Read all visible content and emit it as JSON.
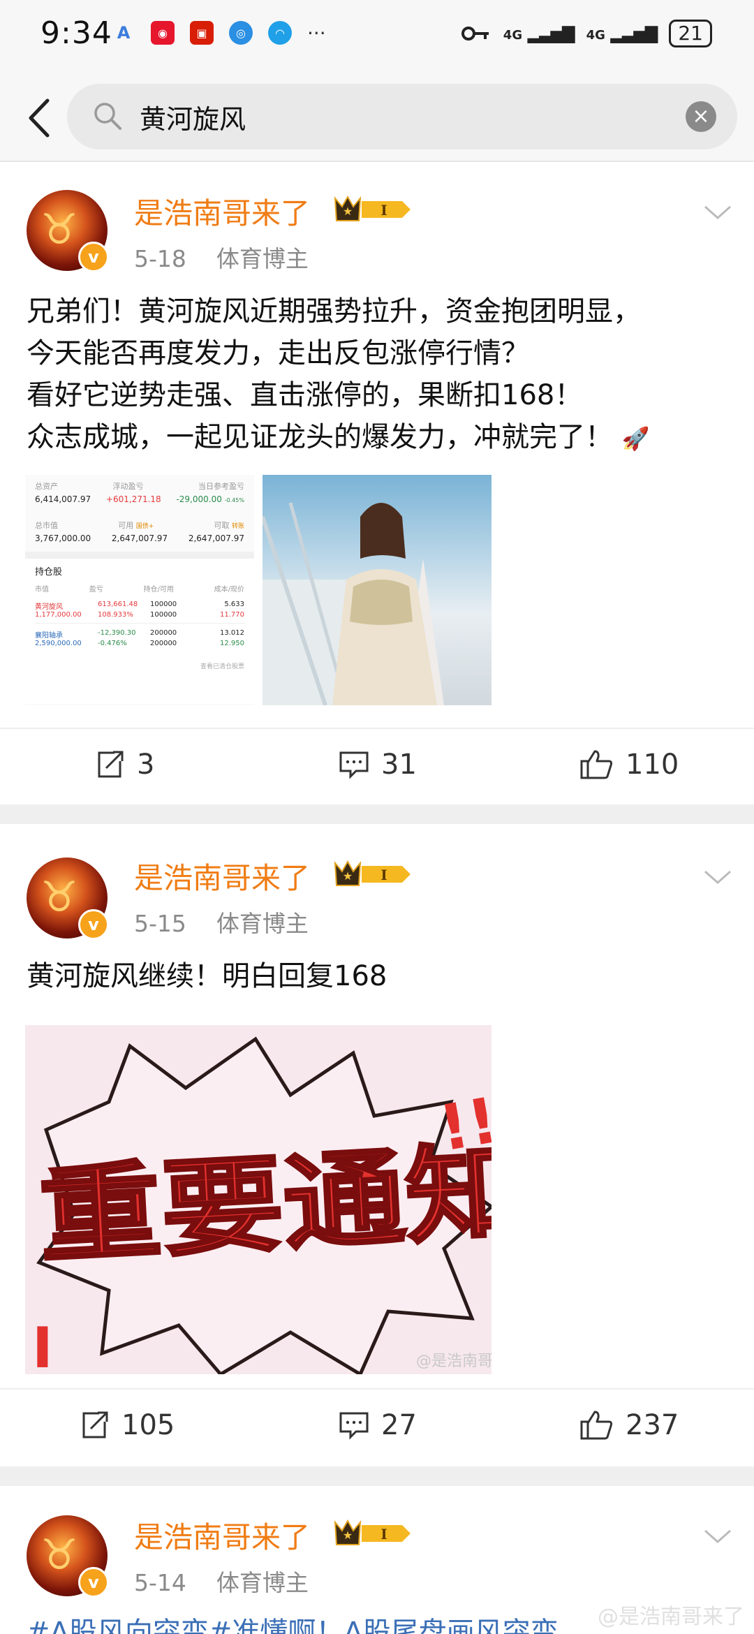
{
  "status": {
    "time": "9:34",
    "network_1": "4G",
    "network_2": "4G",
    "battery": "21",
    "more": "···"
  },
  "search": {
    "query": "黄河旋风"
  },
  "posts": [
    {
      "username": "是浩南哥来了",
      "level_badge": "I",
      "date": "5-18",
      "category": "体育博主",
      "lines": [
        "兄弟们！黄河旋风近期强势拉升，资金抱团明显，",
        "今天能否再度发力，走出反包涨停行情？",
        "看好它逆势走强、直击涨停的，果断扣168！",
        "众志成城，一起见证龙头的爆发力，冲就完了！"
      ],
      "repost_count": "3",
      "comment_count": "31",
      "like_count": "110",
      "portfolio": {
        "labels_row1": [
          "总资产",
          "浮动盈亏",
          "当日参考盈亏"
        ],
        "values_row1": [
          "6,414,007.97",
          "+601,271.18",
          "-29,000.00"
        ],
        "pct_row1": "-0.45%",
        "labels_row2": [
          "总市值",
          "可用",
          "可取"
        ],
        "values_row2": [
          "3,767,000.00",
          "2,647,007.97",
          "2,647,007.97"
        ],
        "tag_available": "国债+",
        "tag_withdraw": "转账",
        "holdings_title": "持仓股",
        "headers": [
          "市值",
          "盈亏",
          "持仓/可用",
          "成本/现价"
        ],
        "rows": [
          {
            "name": "黄河旋风",
            "value": "1,177,000.00",
            "pl": "613,661.48",
            "plpct": "108.933%",
            "pos": "100000",
            "avail": "100000",
            "cost": "5.633",
            "price": "11.770"
          },
          {
            "name": "襄阳轴承",
            "value": "2,590,000.00",
            "pl": "-12,390.30",
            "plpct": "-0.476%",
            "pos": "200000",
            "avail": "200000",
            "cost": "13.012",
            "price": "12.950"
          }
        ],
        "footer": "查看已清仓股票"
      }
    },
    {
      "username": "是浩南哥来了",
      "level_badge": "I",
      "date": "5-15",
      "category": "体育博主",
      "lines": [
        "黄河旋风继续！明白回复168"
      ],
      "poster_text": "重要通知",
      "poster_marks": "!!!",
      "poster_watermark": "@是浩南哥",
      "repost_count": "105",
      "comment_count": "27",
      "like_count": "237"
    },
    {
      "username": "是浩南哥来了",
      "level_badge": "I",
      "date": "5-14",
      "category": "体育博主",
      "lines": [
        "#A股风向突变#准懂啊！A股尾盘画风突变"
      ]
    }
  ],
  "page_watermark": "@是浩南哥来了",
  "colors": {
    "username": "#f07c14",
    "badge": "#f7a21b",
    "up": "#e4393c",
    "down": "#2a8a4a"
  }
}
